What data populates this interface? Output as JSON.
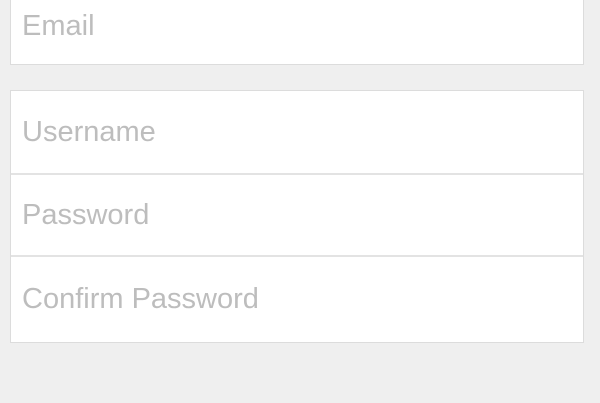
{
  "form": {
    "email_placeholder": "Email",
    "username_placeholder": "Username",
    "password_placeholder": "Password",
    "confirm_password_placeholder": "Confirm Password"
  }
}
